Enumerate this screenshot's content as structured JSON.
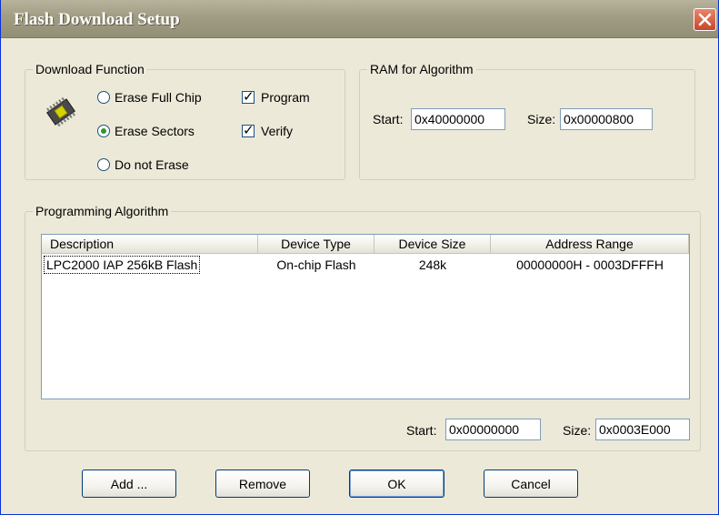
{
  "window": {
    "title": "Flash Download Setup",
    "close_icon": "close-icon"
  },
  "download_function": {
    "legend": "Download Function",
    "chip_icon": "chip-icon",
    "erase_full_chip": {
      "label": "Erase Full Chip",
      "checked": false
    },
    "erase_sectors": {
      "label": "Erase Sectors",
      "checked": true
    },
    "do_not_erase": {
      "label": "Do not Erase",
      "checked": false
    },
    "program": {
      "label": "Program",
      "checked": true
    },
    "verify": {
      "label": "Verify",
      "checked": true
    }
  },
  "ram_for_algorithm": {
    "legend": "RAM for Algorithm",
    "start_label": "Start:",
    "start_value": "0x40000000",
    "size_label": "Size:",
    "size_value": "0x00000800"
  },
  "programming_algorithm": {
    "legend": "Programming Algorithm",
    "columns": [
      "Description",
      "Device Type",
      "Device Size",
      "Address Range"
    ],
    "rows": [
      {
        "description": "LPC2000 IAP 256kB Flash",
        "device_type": "On-chip Flash",
        "device_size": "248k",
        "address_range": "00000000H - 0003DFFFH"
      }
    ],
    "start_label": "Start:",
    "start_value": "0x00000000",
    "size_label": "Size:",
    "size_value": "0x0003E000"
  },
  "buttons": {
    "add": "Add ...",
    "remove": "Remove",
    "ok": "OK",
    "cancel": "Cancel"
  },
  "colors": {
    "dialog_background": "#ece9d8",
    "titlebar": "#a19d84",
    "close_button": "#c9462b",
    "radio_dot": "#2a9a2a"
  }
}
